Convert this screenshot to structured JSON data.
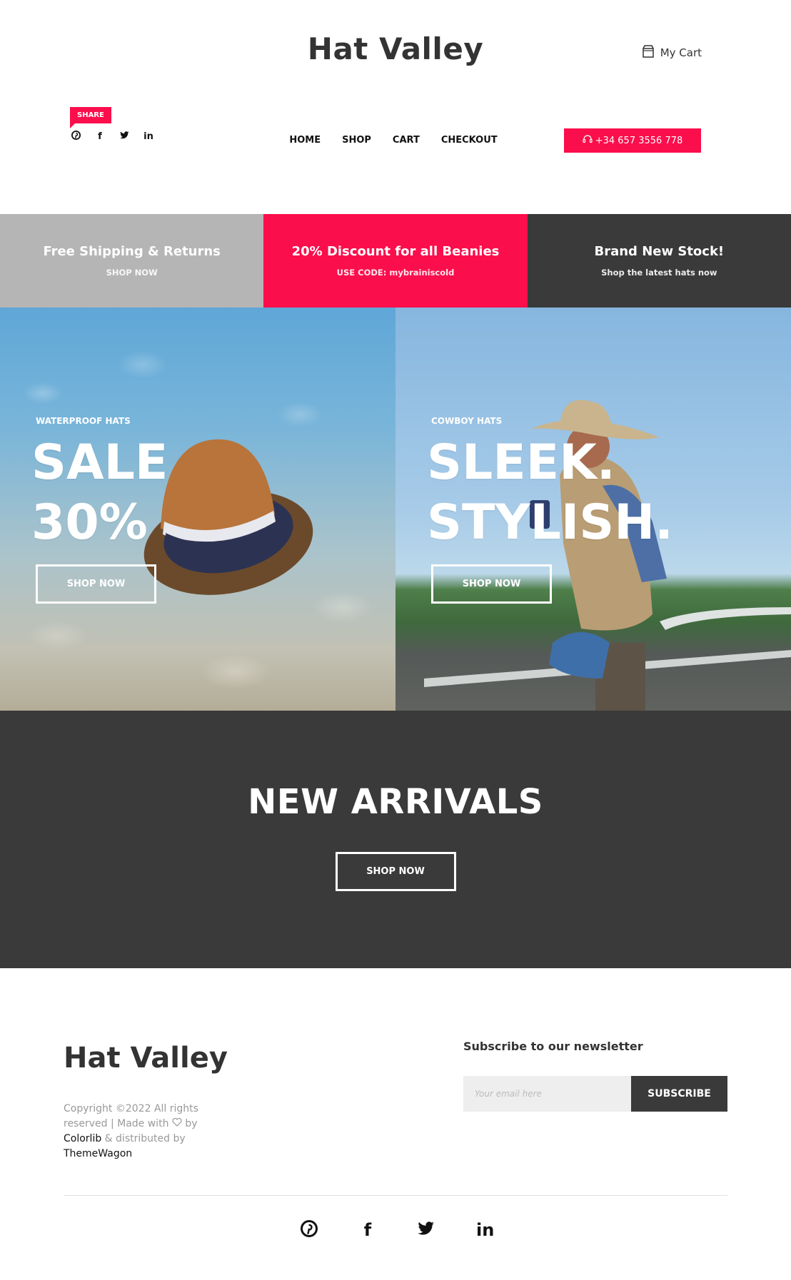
{
  "header": {
    "logo": "Hat Valley",
    "cart_label": "My Cart",
    "share_label": "SHARE",
    "share_icons": [
      "pinterest-icon",
      "facebook-icon",
      "twitter-icon",
      "linkedin-icon"
    ],
    "nav": [
      "HOME",
      "SHOP",
      "CART",
      "CHECKOUT"
    ],
    "phone": "+34 657 3556 778"
  },
  "promos": [
    {
      "title": "Free Shipping & Returns",
      "subtitle": "SHOP NOW",
      "color": "#b5b5b5"
    },
    {
      "title": "20% Discount for all Beanies",
      "subtitle": "USE CODE: mybrainiscold",
      "color": "#fb0e4c"
    },
    {
      "title": "Brand New Stock!",
      "subtitle": "Shop the latest hats now",
      "color": "#3a3a3a"
    }
  ],
  "banners": [
    {
      "category": "WATERPROOF HATS",
      "line1": "SALE",
      "line2": "30%",
      "button": "SHOP NOW"
    },
    {
      "category": "COWBOY HATS",
      "line1": "SLEEK.",
      "line2": "STYLISH.",
      "button": "SHOP NOW"
    }
  ],
  "arrivals": {
    "title": "NEW ARRIVALS",
    "button": "SHOP NOW"
  },
  "footer": {
    "logo": "Hat Valley",
    "copyright_text": "Copyright ©2022 All rights reserved | Made with",
    "by": "by",
    "colorlib": "Colorlib",
    "distributed": "& distributed by",
    "themewagon": "ThemeWagon",
    "newsletter_title": "Subscribe to our newsletter",
    "email_placeholder": "Your email here",
    "subscribe_label": "SUBSCRIBE",
    "social_icons": [
      "pinterest-icon",
      "facebook-icon",
      "twitter-icon",
      "linkedin-icon"
    ]
  },
  "colors": {
    "accent": "#fb0e4c",
    "dark": "#3a3a3a",
    "grey": "#b5b5b5"
  }
}
